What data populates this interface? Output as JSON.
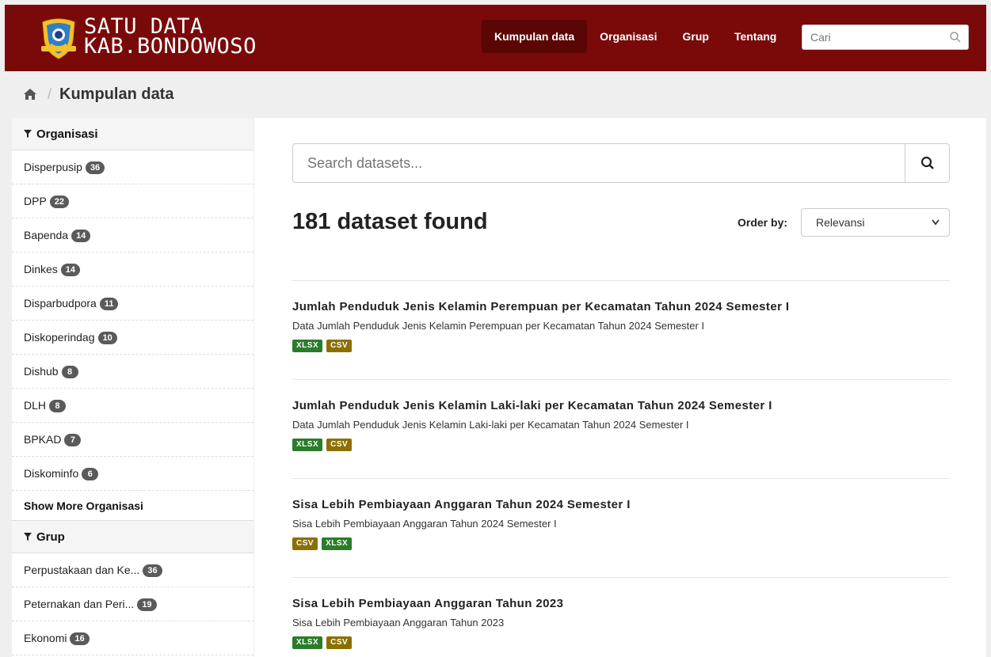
{
  "header": {
    "brand_line1": "SATU DATA",
    "brand_line2": "KAB.BONDOWOSO",
    "nav": [
      "Kumpulan data",
      "Organisasi",
      "Grup",
      "Tentang"
    ],
    "search_placeholder": "Cari",
    "bg_color": "#7a0a0a"
  },
  "breadcrumb": {
    "current": "Kumpulan data"
  },
  "sidebar": {
    "org_title": "Organisasi",
    "orgs": [
      {
        "name": "Disperpusip",
        "count": "36"
      },
      {
        "name": "DPP",
        "count": "22"
      },
      {
        "name": "Bapenda",
        "count": "14"
      },
      {
        "name": "Dinkes",
        "count": "14"
      },
      {
        "name": "Disparbudpora",
        "count": "11"
      },
      {
        "name": "Diskoperindag",
        "count": "10"
      },
      {
        "name": "Dishub",
        "count": "8"
      },
      {
        "name": "DLH",
        "count": "8"
      },
      {
        "name": "BPKAD",
        "count": "7"
      },
      {
        "name": "Diskominfo",
        "count": "6"
      }
    ],
    "show_more": "Show More Organisasi",
    "group_title": "Grup",
    "groups": [
      {
        "name": "Perpustakaan dan Ke...",
        "count": "36"
      },
      {
        "name": "Peternakan dan Peri...",
        "count": "19"
      },
      {
        "name": "Ekonomi",
        "count": "16"
      }
    ]
  },
  "main": {
    "search_placeholder": "Search datasets...",
    "count_text": "181 dataset found",
    "order_label": "Order by:",
    "order_value": "Relevansi",
    "datasets": [
      {
        "title": "Jumlah Penduduk Jenis Kelamin Perempuan per Kecamatan Tahun 2024 Semester I",
        "desc": "Data Jumlah Penduduk Jenis Kelamin Perempuan per Kecamatan Tahun 2024 Semester I",
        "formats": [
          "XLSX",
          "CSV"
        ]
      },
      {
        "title": "Jumlah Penduduk Jenis Kelamin Laki-laki per Kecamatan Tahun 2024 Semester I",
        "desc": "Data Jumlah Penduduk Jenis Kelamin Laki-laki per Kecamatan Tahun 2024 Semester I",
        "formats": [
          "XLSX",
          "CSV"
        ]
      },
      {
        "title": "Sisa Lebih Pembiayaan Anggaran Tahun 2024 Semester I",
        "desc": "Sisa Lebih Pembiayaan Anggaran Tahun 2024 Semester I",
        "formats": [
          "CSV",
          "XLSX"
        ]
      },
      {
        "title": "Sisa Lebih Pembiayaan Anggaran Tahun 2023",
        "desc": "Sisa Lebih Pembiayaan Anggaran Tahun 2023",
        "formats": [
          "XLSX",
          "CSV"
        ]
      }
    ]
  }
}
